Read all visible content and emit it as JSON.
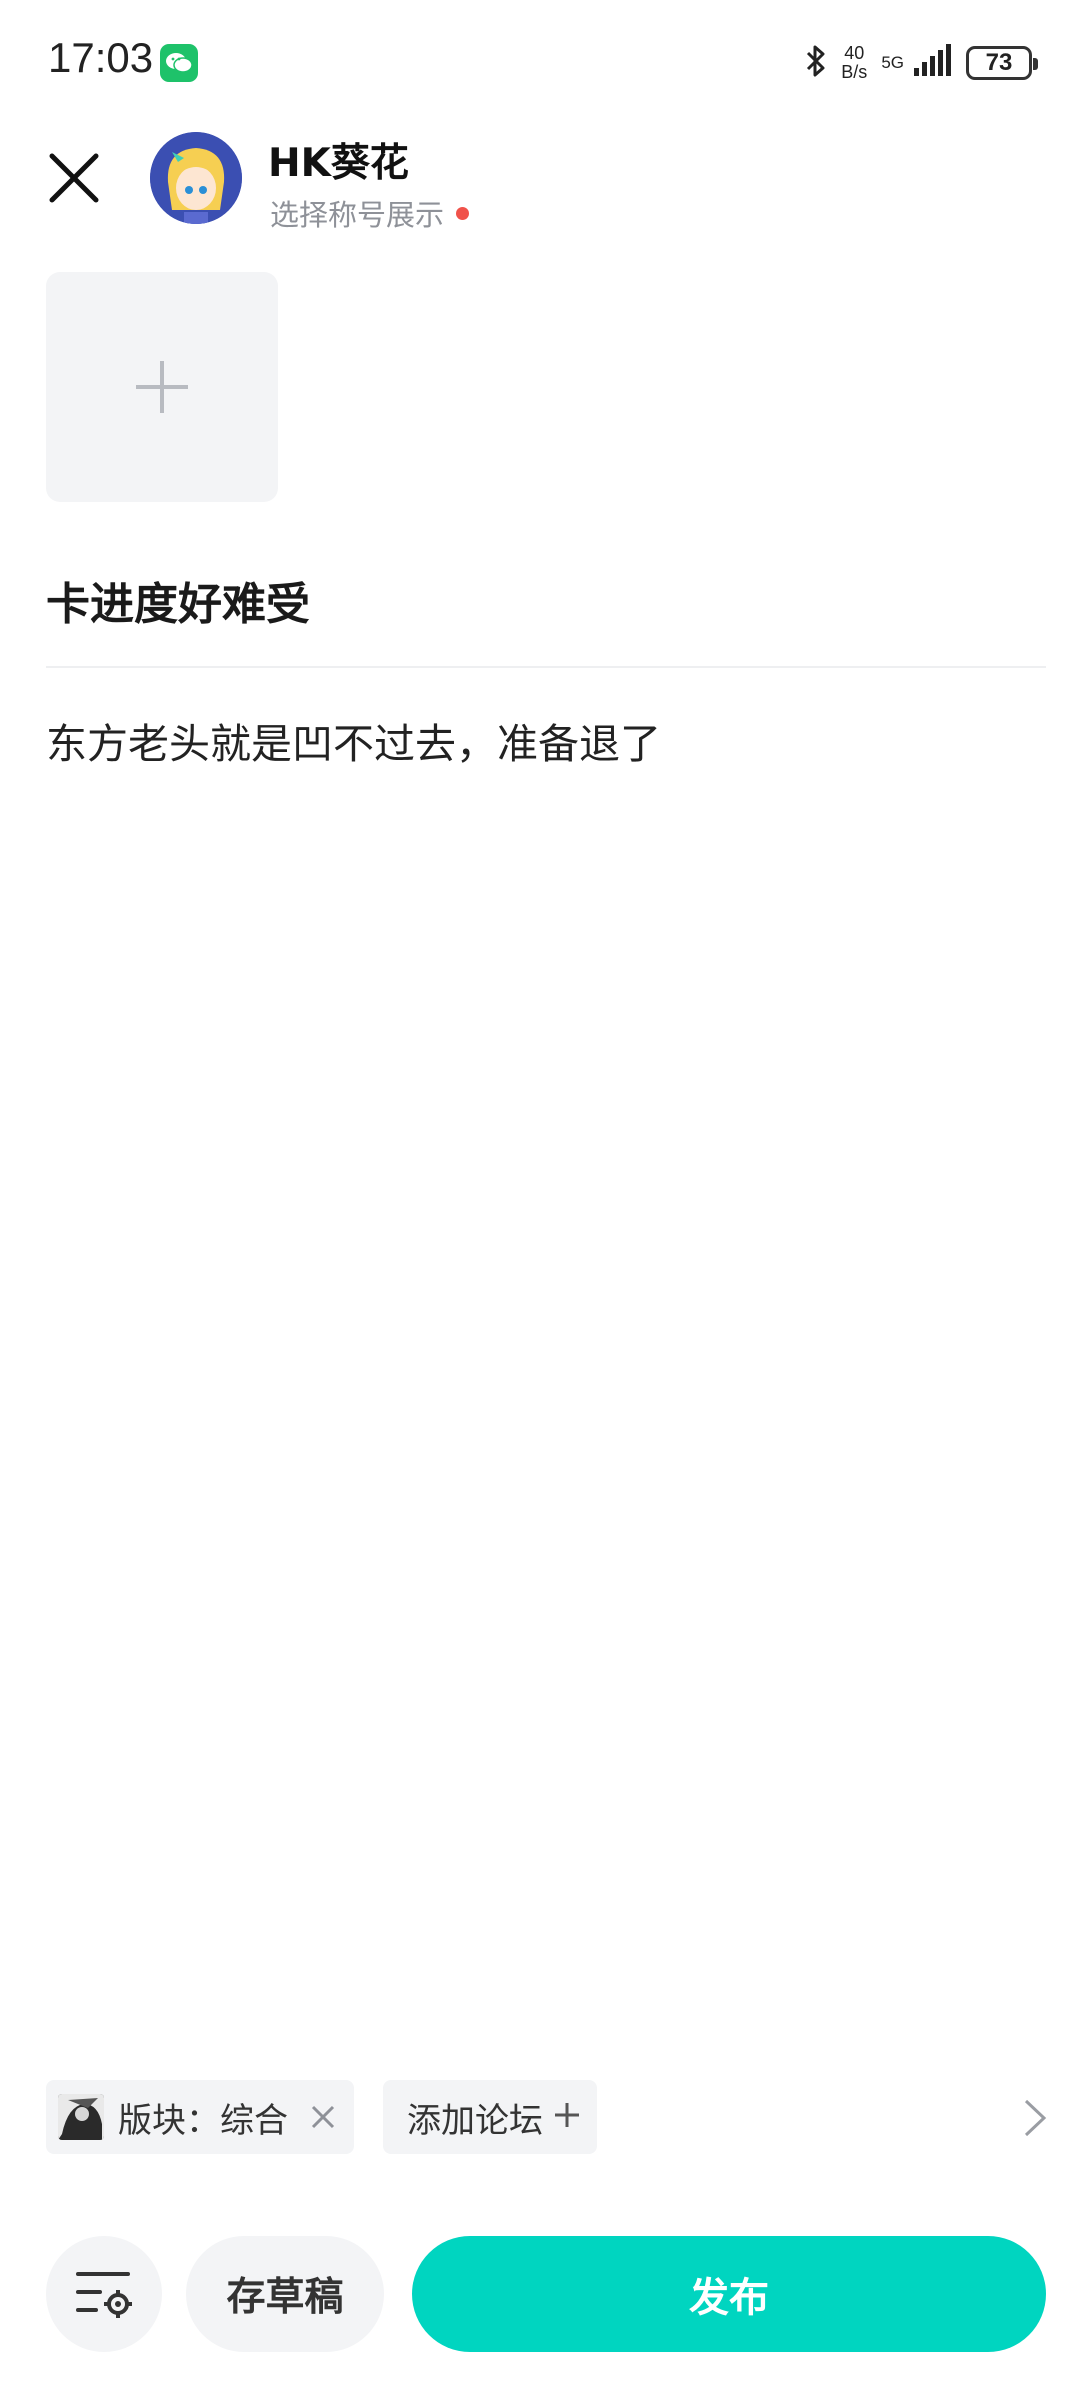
{
  "status_bar": {
    "time": "17:03",
    "net_speed_value": "40",
    "net_speed_unit": "B/s",
    "network_type": "5G",
    "battery_level": "73"
  },
  "header": {
    "user_name": "HK葵花",
    "title_select_label": "选择称号展示"
  },
  "post": {
    "title": "卡进度好难受",
    "body": "东方老头就是凹不过去，准备退了"
  },
  "tags": {
    "forum_label": "版块：综合",
    "add_forum_label": "添加论坛"
  },
  "bottom_bar": {
    "draft_label": "存草稿",
    "publish_label": "发布"
  },
  "colors": {
    "accent": "#00d5c0",
    "notification_dot": "#f0524a",
    "wechat_green": "#1ec26a"
  },
  "icons": [
    "close-icon",
    "plus-icon",
    "tag-close-icon",
    "chevron-right-icon",
    "settings-list-icon",
    "bluetooth-icon",
    "signal-icon",
    "wechat-icon"
  ]
}
